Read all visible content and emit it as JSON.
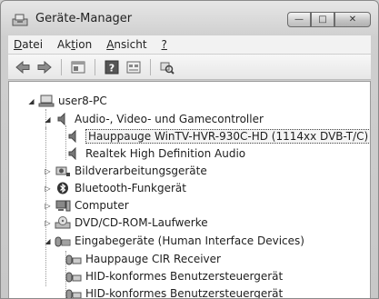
{
  "window": {
    "title": "Geräte-Manager"
  },
  "menu": [
    {
      "pre": "",
      "key": "D",
      "post": "atei"
    },
    {
      "pre": "Ak",
      "key": "t",
      "post": "ion"
    },
    {
      "pre": "",
      "key": "A",
      "post": "nsicht"
    },
    {
      "pre": "",
      "key": "?",
      "post": ""
    }
  ],
  "titlebar_buttons": {
    "minimize": "—",
    "maximize": "□",
    "close": "✕"
  },
  "toolbar_icons": [
    "back-icon",
    "forward-icon",
    "properties-icon",
    "help-icon",
    "view-icon",
    "scan-hardware-icon"
  ],
  "tree": {
    "root": {
      "label": "user8-PC",
      "expanded": true
    },
    "categories": [
      {
        "label": "Audio-, Video- und Gamecontroller",
        "icon": "speaker-icon",
        "expanded": true,
        "children": [
          {
            "label": "Hauppauge WinTV-HVR-930C-HD (1114xx DVB-T/C)",
            "icon": "speaker-icon",
            "selected": true
          },
          {
            "label": "Realtek High Definition Audio",
            "icon": "speaker-icon",
            "selected": false
          }
        ]
      },
      {
        "label": "Bildverarbeitungsgeräte",
        "icon": "camera-icon",
        "expanded": false,
        "children": []
      },
      {
        "label": "Bluetooth-Funkgerät",
        "icon": "bluetooth-icon",
        "expanded": false,
        "children": []
      },
      {
        "label": "Computer",
        "icon": "computer-icon",
        "expanded": false,
        "children": []
      },
      {
        "label": "DVD/CD-ROM-Laufwerke",
        "icon": "disc-drive-icon",
        "expanded": false,
        "children": []
      },
      {
        "label": "Eingabegeräte (Human Interface Devices)",
        "icon": "hid-icon",
        "expanded": true,
        "children": [
          {
            "label": "Hauppauge CIR Receiver",
            "icon": "hid-icon",
            "selected": false
          },
          {
            "label": "HID-konformes Benutzersteuergerät",
            "icon": "hid-icon",
            "selected": false
          },
          {
            "label": "HID-konformes Benutzersteuergerät",
            "icon": "hid-icon",
            "selected": false
          }
        ]
      }
    ]
  }
}
